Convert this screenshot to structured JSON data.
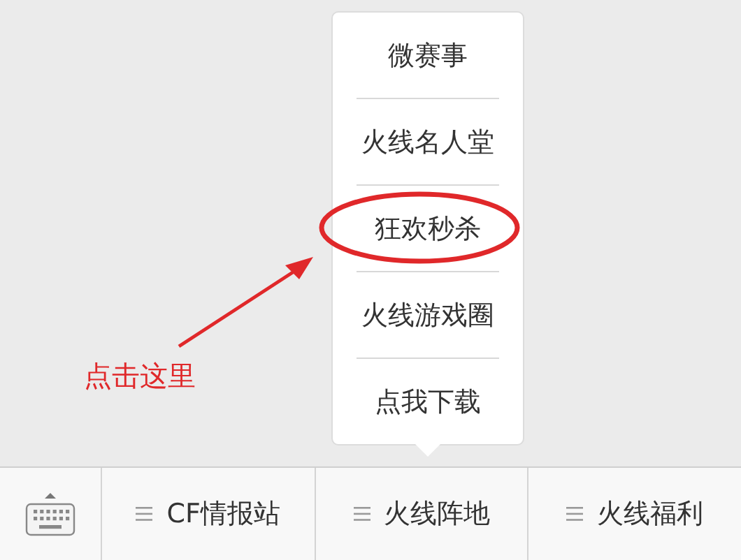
{
  "annotation": {
    "label": "点击这里"
  },
  "bottom_bar": {
    "tabs": [
      {
        "label": "CF情报站"
      },
      {
        "label": "火线阵地",
        "menu": [
          {
            "label": "微赛事",
            "circled": false
          },
          {
            "label": "火线名人堂",
            "circled": false
          },
          {
            "label": "狂欢秒杀",
            "circled": true
          },
          {
            "label": "火线游戏圈",
            "circled": false
          },
          {
            "label": "点我下载",
            "circled": false
          }
        ]
      },
      {
        "label": "火线福利"
      }
    ]
  }
}
